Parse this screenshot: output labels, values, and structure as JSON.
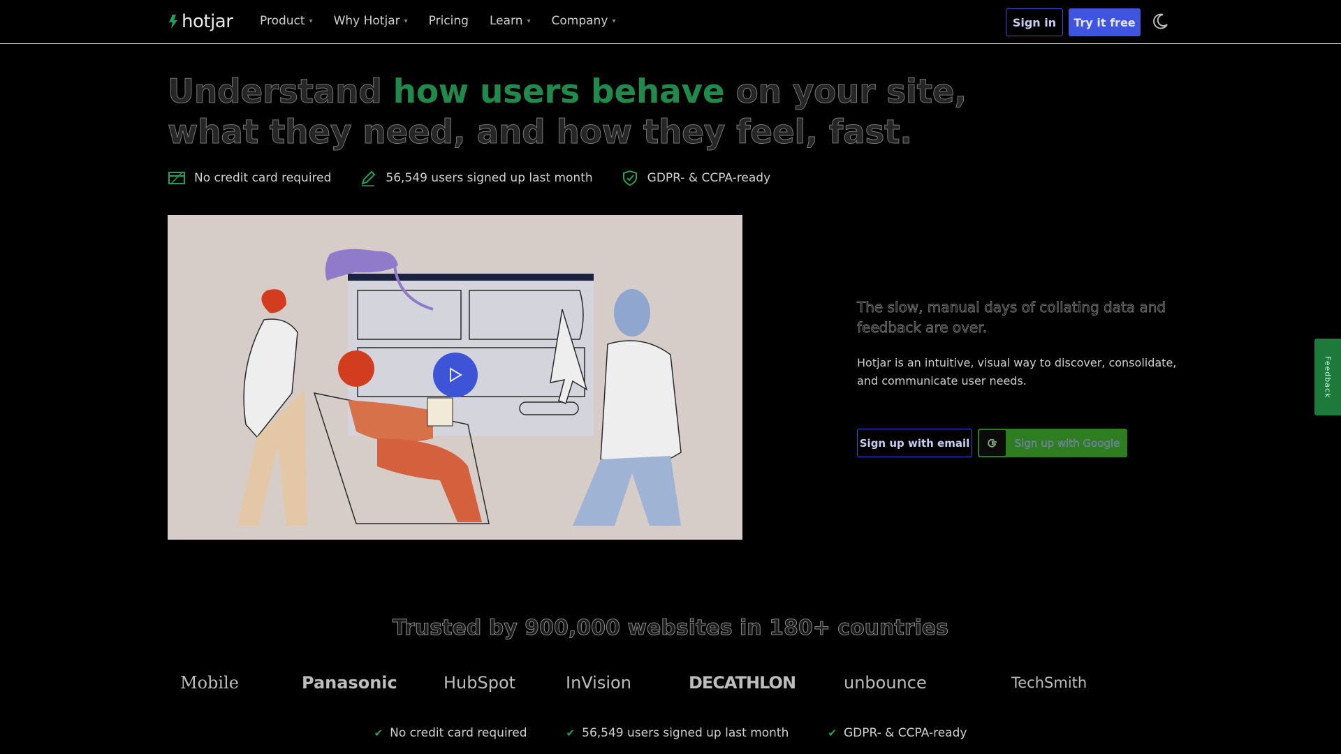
{
  "header": {
    "brand": "hotjar",
    "nav": [
      {
        "label": "Product",
        "dropdown": true
      },
      {
        "label": "Why Hotjar",
        "dropdown": true
      },
      {
        "label": "Pricing",
        "dropdown": false
      },
      {
        "label": "Learn",
        "dropdown": true
      },
      {
        "label": "Company",
        "dropdown": true
      }
    ],
    "signin_label": "Sign in",
    "try_label": "Try it free"
  },
  "hero": {
    "title_pre": "Understand ",
    "title_highlight": "how users behave",
    "title_post": " on your site, what they need, and how they feel, fast.",
    "perks": [
      {
        "icon": "credit-card-icon",
        "label": "No credit card required"
      },
      {
        "icon": "pencil-icon",
        "label": "56,549 users signed up last month"
      },
      {
        "icon": "shield-check-icon",
        "label": "GDPR- & CCPA-ready"
      }
    ]
  },
  "copy": {
    "title": "The slow, manual days of collating data and feedback are over.",
    "body": "Hotjar is an intuitive, visual way to discover, consolidate, and communicate user needs.",
    "email_label": "Sign up with email",
    "google_label": "Sign up with Google"
  },
  "feedback_label": "Feedback",
  "trusted": {
    "title": "Trusted by 900,000 websites in 180+ countries",
    "brands": [
      "Mobile",
      "Panasonic",
      "HubSpot",
      "InVision",
      "DECATHLON",
      "unbounce",
      "TechSmith"
    ]
  },
  "bottom_perks": [
    "No credit card required",
    "56,549 users signed up last month",
    "GDPR- & CCPA-ready"
  ],
  "colors": {
    "accent": "#3f55e0",
    "highlight": "#1f8a4c",
    "google": "#2e7d21"
  }
}
